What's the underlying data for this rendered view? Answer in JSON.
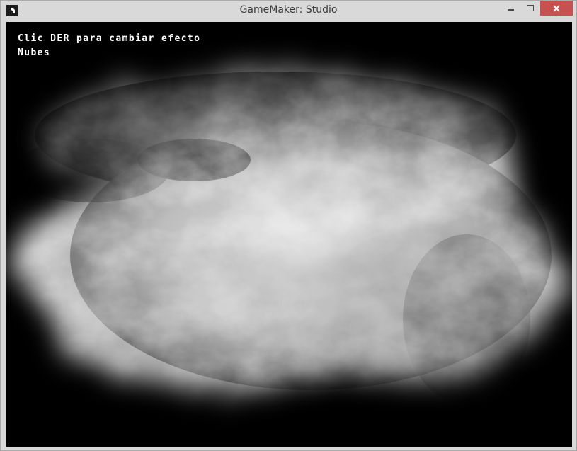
{
  "window": {
    "title": "GameMaker: Studio",
    "icon": "gamemaker-icon",
    "controls": {
      "minimize": "minimize-icon",
      "maximize": "maximize-icon",
      "close": "close-icon",
      "close_color": "#c75050"
    }
  },
  "game": {
    "background_color": "#000000",
    "hud": {
      "instruction": "Clic DER para cambiar efecto",
      "effect_name": "Nubes"
    },
    "effect": "clouds"
  }
}
